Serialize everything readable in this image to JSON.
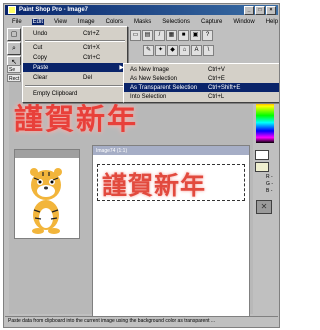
{
  "window": {
    "title": "Paint Shop Pro - Image7"
  },
  "menubar": [
    "File",
    "Edit",
    "View",
    "Image",
    "Colors",
    "Masks",
    "Selections",
    "Capture",
    "Window",
    "Help"
  ],
  "edit_menu": [
    {
      "label": "Undo",
      "shortcut": "Ctrl+Z"
    },
    {
      "label": "Cut",
      "shortcut": "Ctrl+X"
    },
    {
      "label": "Copy",
      "shortcut": "Ctrl+C"
    },
    {
      "label": "Paste",
      "shortcut": ""
    },
    {
      "label": "Clear",
      "shortcut": "Del"
    },
    {
      "label": "Empty Clipboard",
      "shortcut": ""
    }
  ],
  "paste_submenu": [
    {
      "label": "As New Image",
      "shortcut": "Ctrl+V"
    },
    {
      "label": "As New Selection",
      "shortcut": "Ctrl+E"
    },
    {
      "label": "As Transparent Selection",
      "shortcut": "Ctrl+Shift+E"
    },
    {
      "label": "Into Selection",
      "shortcut": "Ctrl+L"
    }
  ],
  "side_tabs": [
    "Se",
    "Rect"
  ],
  "canvas_text": "謹賀新年",
  "tiger_window": {
    "title": ""
  },
  "image_window": {
    "title": "Image74 (1:1)"
  },
  "status_text": "Paste data from clipboard into the current image using the background color as transparent ...",
  "colors": {
    "title_bar": "#08246b",
    "highlight": "#0a246a",
    "red_text": "#e8403a"
  }
}
